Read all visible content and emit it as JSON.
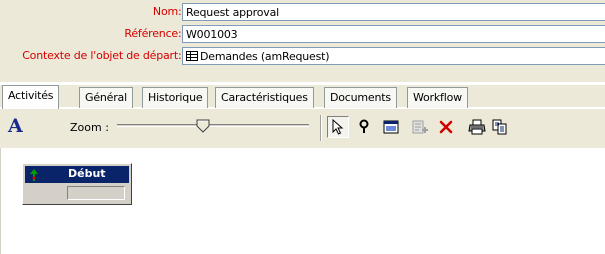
{
  "form": {
    "nom": {
      "label": "Nom",
      "value": "Request approval"
    },
    "reference": {
      "label": "Référence",
      "value": "W001003"
    },
    "contexte": {
      "label": "Contexte de l'objet de départ",
      "value": "Demandes (amRequest)"
    }
  },
  "tabs": [
    {
      "label": "Activités",
      "active": true
    },
    {
      "label": "Général"
    },
    {
      "label": "Historique"
    },
    {
      "label": "Caractéristiques"
    },
    {
      "label": "Documents"
    },
    {
      "label": "Workflow"
    }
  ],
  "toolbar": {
    "font_icon_glyph": "A",
    "zoom_label": "Zoom :",
    "zoom_level": 0.45
  },
  "canvas": {
    "node": {
      "title": "Début"
    }
  },
  "colors": {
    "label_red": "#d40000",
    "node_title_bg": "#0a246a",
    "panel_bg": "#ece9d8"
  }
}
